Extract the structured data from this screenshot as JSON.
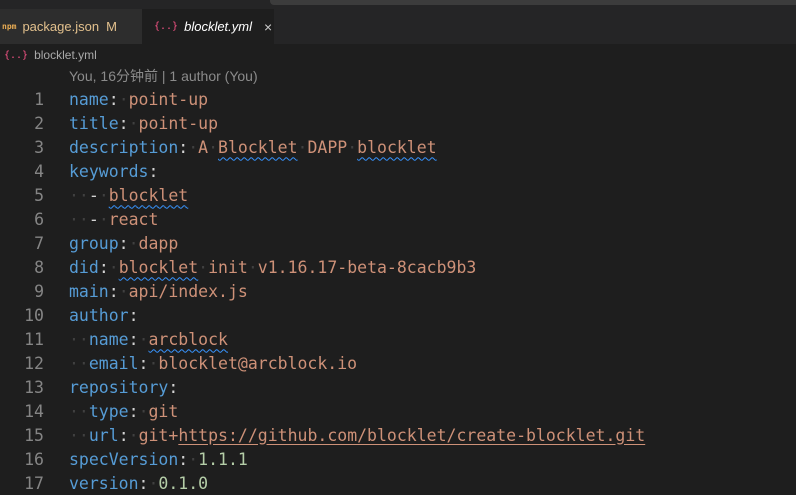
{
  "tabs": [
    {
      "icon": "npm",
      "label": "package.json",
      "badge": "M"
    },
    {
      "icon": "{..}",
      "label": "blocklet.yml",
      "close": "×"
    }
  ],
  "breadcrumb": {
    "icon": "{..}",
    "file": "blocklet.yml"
  },
  "blame": "You, 16分钟前 | 1 author (You)",
  "editor": {
    "lines": [
      {
        "num": "1",
        "key": "name",
        "value": "point-up"
      },
      {
        "num": "2",
        "key": "title",
        "value": "point-up"
      },
      {
        "num": "3",
        "key": "description",
        "v1": "A",
        "v2": "Blocklet",
        "v3": "DAPP",
        "v4": "blocklet"
      },
      {
        "num": "4",
        "key": "keywords"
      },
      {
        "num": "5",
        "dash": "-",
        "value": "blocklet"
      },
      {
        "num": "6",
        "dash": "-",
        "value": "react"
      },
      {
        "num": "7",
        "key": "group",
        "value": "dapp"
      },
      {
        "num": "8",
        "key": "did",
        "v1": "blocklet",
        "v2": "init",
        "v3": "v1.16.17-beta-8cacb9b3"
      },
      {
        "num": "9",
        "key": "main",
        "value": "api/index.js"
      },
      {
        "num": "10",
        "key": "author"
      },
      {
        "num": "11",
        "key": "name",
        "value": "arcblock"
      },
      {
        "num": "12",
        "key": "email",
        "value": "blocklet@arcblock.io"
      },
      {
        "num": "13",
        "key": "repository"
      },
      {
        "num": "14",
        "key": "type",
        "value": "git"
      },
      {
        "num": "15",
        "key": "url",
        "prefix": "git+",
        "url": "https://github.com/blocklet/create-blocklet.git"
      },
      {
        "num": "16",
        "key": "specVersion",
        "value": "1.1.1"
      },
      {
        "num": "17",
        "key": "version",
        "value": "0.1.0"
      }
    ]
  }
}
